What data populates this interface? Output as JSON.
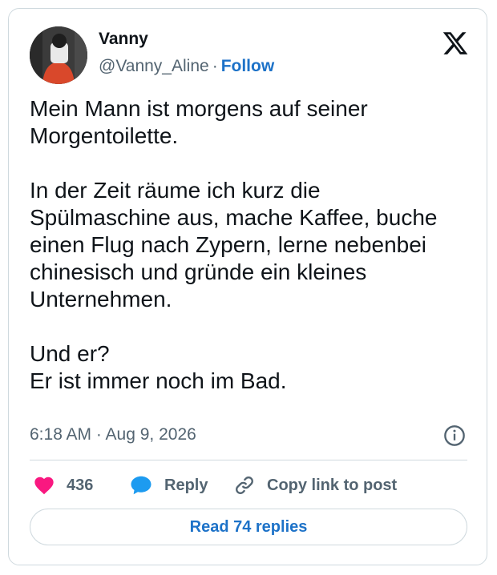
{
  "author": {
    "name": "Vanny",
    "handle": "@Vanny_Aline",
    "separator": "·",
    "follow_label": "Follow"
  },
  "tweet": {
    "paragraphs": [
      "Mein Mann ist morgens auf seiner\nMorgentoilette.",
      "In der Zeit räume ich kurz die\nSpülmaschine aus, mache Kaffee, buche\neinen Flug nach Zypern, lerne nebenbei\nchinesisch und gründe ein kleines\nUnternehmen.",
      "Und er?\nEr ist immer noch im Bad."
    ],
    "timestamp": "6:18 AM · Aug 9, 2026"
  },
  "actions": {
    "like_count": "436",
    "reply_label": "Reply",
    "copy_link_label": "Copy link to post",
    "read_replies_label": "Read 74 replies"
  },
  "icons": {
    "logo": "x-logo-icon",
    "info": "info-icon",
    "like": "heart-icon",
    "reply": "speech-bubble-icon",
    "copy": "link-icon"
  },
  "colors": {
    "like": "#f91880",
    "reply": "#1d9bf0",
    "link": "#1d72c8",
    "secondary_text": "#536471",
    "border": "#cfd9de"
  }
}
